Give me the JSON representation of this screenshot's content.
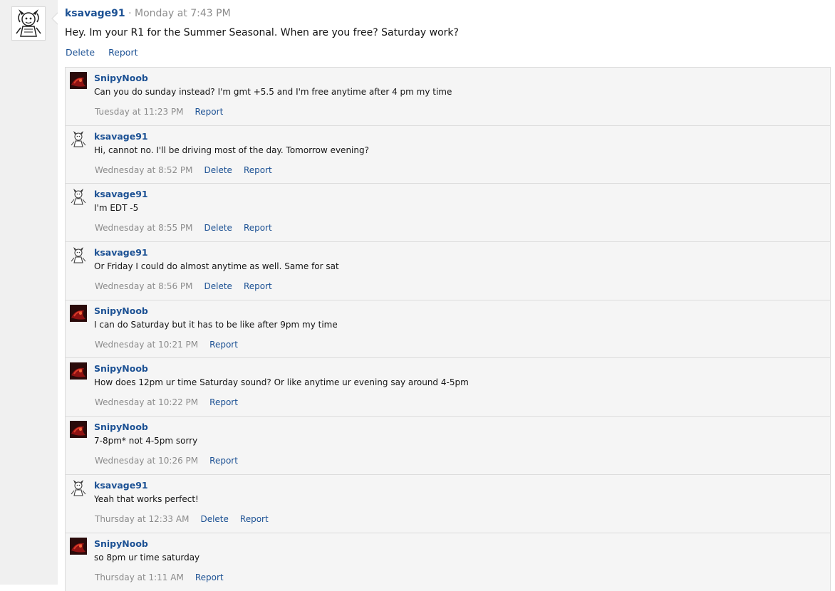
{
  "status": {
    "author": "ksavage91",
    "separator": "·",
    "time": "Monday at 7:43 PM",
    "text": "Hey. Im your R1 for the Summer Seasonal. When are you free? Saturday work?",
    "delete_label": "Delete",
    "report_label": "Report"
  },
  "comments": [
    {
      "author": "SnipyNoob",
      "avatar": "snipynoob-avatar",
      "text": "Can you do sunday instead? I'm gmt +5.5 and I'm free anytime after 4 pm my time",
      "time": "Tuesday at 11:23 PM",
      "delete_label": "",
      "report_label": "Report"
    },
    {
      "author": "ksavage91",
      "avatar": "ksavage91-avatar",
      "text": "Hi, cannot no. I'll be driving most of the day. Tomorrow evening?",
      "time": "Wednesday at 8:52 PM",
      "delete_label": "Delete",
      "report_label": "Report"
    },
    {
      "author": "ksavage91",
      "avatar": "ksavage91-avatar",
      "text": "I'm EDT -5",
      "time": "Wednesday at 8:55 PM",
      "delete_label": "Delete",
      "report_label": "Report"
    },
    {
      "author": "ksavage91",
      "avatar": "ksavage91-avatar",
      "text": "Or Friday I could do almost anytime as well. Same for sat",
      "time": "Wednesday at 8:56 PM",
      "delete_label": "Delete",
      "report_label": "Report"
    },
    {
      "author": "SnipyNoob",
      "avatar": "snipynoob-avatar",
      "text": "I can do Saturday but it has to be like after 9pm my time",
      "time": "Wednesday at 10:21 PM",
      "delete_label": "",
      "report_label": "Report"
    },
    {
      "author": "SnipyNoob",
      "avatar": "snipynoob-avatar",
      "text": "How does 12pm ur time Saturday sound? Or like anytime ur evening say around 4-5pm",
      "time": "Wednesday at 10:22 PM",
      "delete_label": "",
      "report_label": "Report"
    },
    {
      "author": "SnipyNoob",
      "avatar": "snipynoob-avatar",
      "text": "7-8pm* not 4-5pm sorry",
      "time": "Wednesday at 10:26 PM",
      "delete_label": "",
      "report_label": "Report"
    },
    {
      "author": "ksavage91",
      "avatar": "ksavage91-avatar",
      "text": "Yeah that works perfect!",
      "time": "Thursday at 12:33 AM",
      "delete_label": "Delete",
      "report_label": "Report"
    },
    {
      "author": "SnipyNoob",
      "avatar": "snipynoob-avatar",
      "text": "so 8pm ur time saturday",
      "time": "Thursday at 1:11 AM",
      "delete_label": "",
      "report_label": "Report"
    }
  ]
}
